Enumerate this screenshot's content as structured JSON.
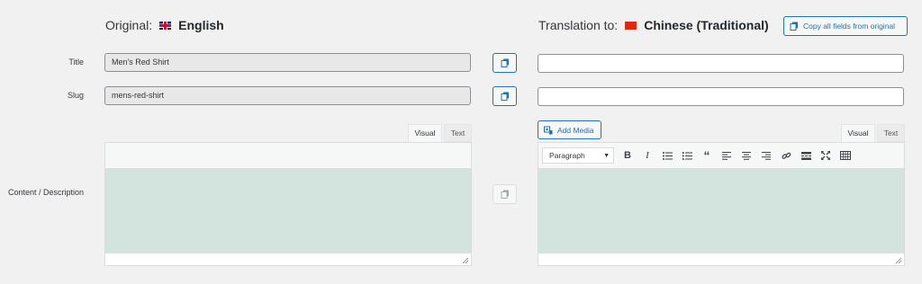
{
  "header": {
    "original_label": "Original:",
    "original_lang": "English",
    "translation_label": "Translation to:",
    "translation_lang": "Chinese (Traditional)",
    "copy_all_label": "Copy all fields from original"
  },
  "fields": {
    "title_label": "Title",
    "title_original": "Men's Red Shirt",
    "title_translation": "",
    "slug_label": "Slug",
    "slug_original": "mens-red-shirt",
    "slug_translation": "",
    "content_label": "Content / Description"
  },
  "editor": {
    "tab_visual": "Visual",
    "tab_text": "Text",
    "add_media_label": "Add Media",
    "format_select": "Paragraph",
    "toolbar_icons": [
      "bold-icon",
      "italic-icon",
      "bullet-list-icon",
      "numbered-list-icon",
      "blockquote-icon",
      "align-left-icon",
      "align-center-icon",
      "align-right-icon",
      "link-icon",
      "read-more-icon",
      "fullscreen-icon",
      "toolbar-toggle-icon"
    ]
  },
  "colors": {
    "accent": "#2271b1",
    "content_bg": "#d3e4df",
    "page_bg": "#f1f1f1"
  }
}
